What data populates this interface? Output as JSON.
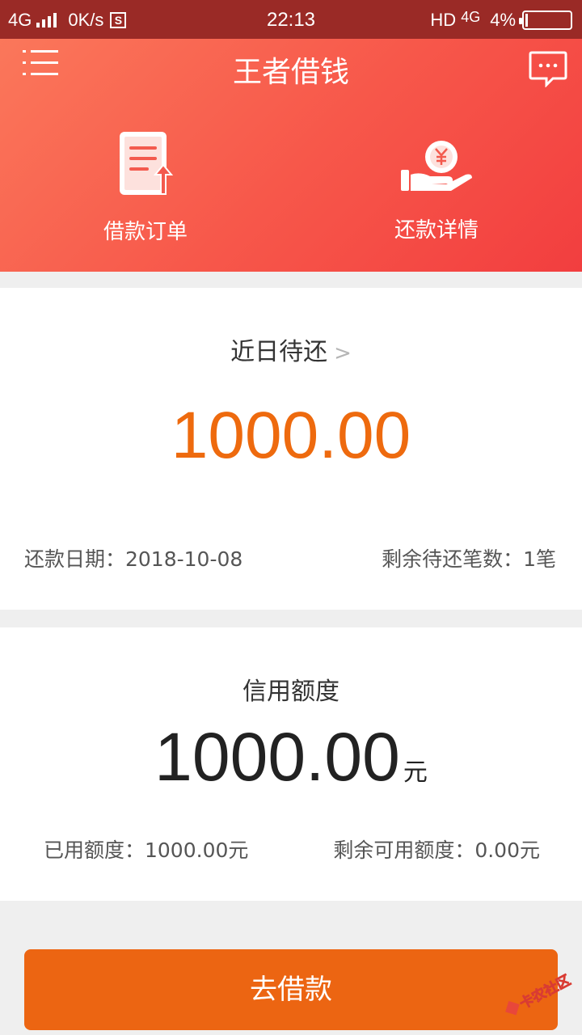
{
  "status_bar": {
    "network_left": "4G",
    "speed": "0K/s",
    "time": "22:13",
    "hd": "HD",
    "network_right": "4G",
    "battery": "4%"
  },
  "header": {
    "title": "王者借钱",
    "icons": {
      "menu": "menu-icon",
      "messages": "chat-bubble-icon"
    }
  },
  "quick_actions": [
    {
      "label": "借款订单",
      "icon": "document-upload-icon"
    },
    {
      "label": "还款详情",
      "icon": "yuan-coin-hand-icon"
    }
  ],
  "due_card": {
    "title": "近日待还",
    "amount": "1000.00",
    "date_text": "还款日期：2018-10-08",
    "count_text": "剩余待还笔数：1笔"
  },
  "credit_card": {
    "title": "信用额度",
    "amount": "1000.00",
    "unit": "元",
    "used_text": "已用额度：1000.00元",
    "remain_text": "剩余可用额度：0.00元"
  },
  "actions": {
    "borrow": "去借款"
  },
  "watermark": {
    "text": "卡农社区"
  },
  "colors": {
    "accent": "#ec6512",
    "header_start": "#fb7a5c",
    "header_end": "#f23e3f",
    "amount": "#ee6a0e"
  }
}
